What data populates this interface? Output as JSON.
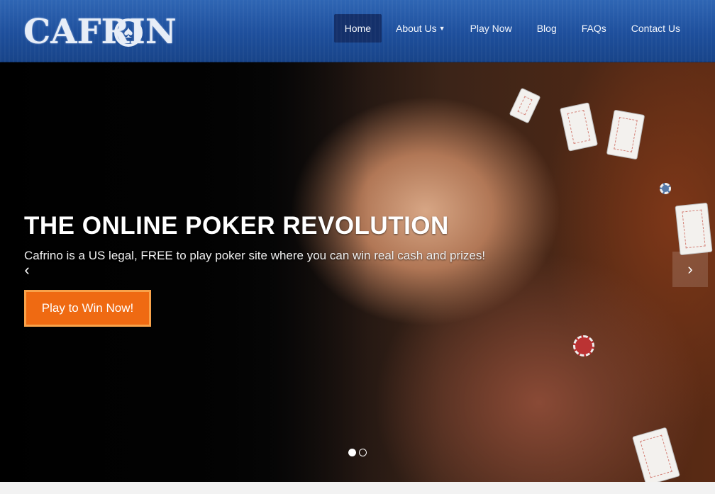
{
  "brand": {
    "logo_text": "CAFRIN",
    "logo_icon": "spade-icon"
  },
  "nav": {
    "items": [
      {
        "label": "Home",
        "active": true
      },
      {
        "label": "About Us",
        "dropdown": true
      },
      {
        "label": "Play Now"
      },
      {
        "label": "Blog"
      },
      {
        "label": "FAQs"
      },
      {
        "label": "Contact Us"
      }
    ],
    "dropdown_icon": "chevron-down-icon"
  },
  "hero": {
    "title": "THE ONLINE POKER REVOLUTION",
    "subtitle": "Cafrino is a US legal, FREE to play poker site where you can win real cash and prizes!",
    "cta_label": "Play to Win Now!",
    "prev_icon": "chevron-left-icon",
    "next_icon": "chevron-right-icon",
    "slides_total": 2,
    "active_slide": 1
  },
  "colors": {
    "header": "#1e4f9c",
    "nav_active": "#14306a",
    "cta": "#ef6a12",
    "cta_border": "#f8a24a"
  }
}
